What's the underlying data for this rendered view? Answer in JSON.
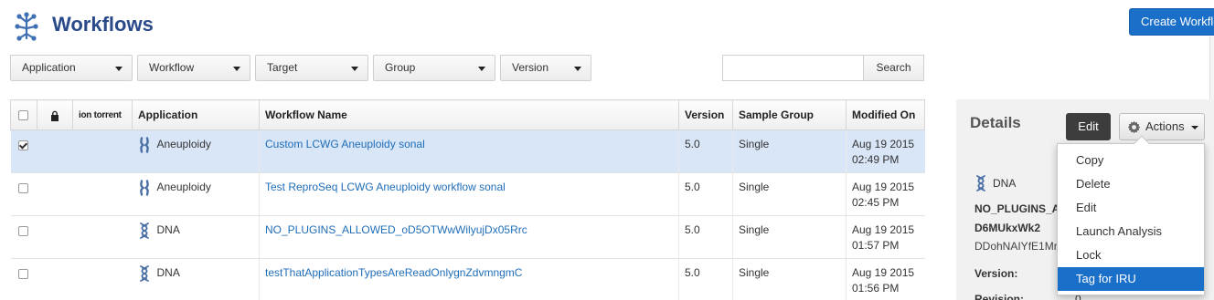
{
  "header": {
    "title": "Workflows",
    "create_button": "Create Workflow"
  },
  "filters": [
    {
      "label": "Application"
    },
    {
      "label": "Workflow"
    },
    {
      "label": "Target"
    },
    {
      "label": "Group"
    },
    {
      "label": "Version"
    }
  ],
  "search": {
    "value": "",
    "button": "Search"
  },
  "table": {
    "columns": [
      "",
      "",
      "ion torrent",
      "Application",
      "Workflow Name",
      "Version",
      "Sample Group",
      "Modified On"
    ],
    "rows": [
      {
        "checked": true,
        "app_icon": "chromosome-icon",
        "application": "Aneuploidy",
        "name": "Custom LCWG Aneuploidy sonal",
        "version": "5.0",
        "group": "Single",
        "date": "Aug 19 2015",
        "time": "02:49 PM"
      },
      {
        "checked": false,
        "app_icon": "chromosome-icon",
        "application": "Aneuploidy",
        "name": "Test ReproSeq LCWG Aneuploidy workflow sonal",
        "version": "5.0",
        "group": "Single",
        "date": "Aug 19 2015",
        "time": "02:45 PM"
      },
      {
        "checked": false,
        "app_icon": "dna-icon",
        "application": "DNA",
        "name": "NO_PLUGINS_ALLOWED_oD5OTWwWilyujDx05Rrc",
        "version": "5.0",
        "group": "Single",
        "date": "Aug 19 2015",
        "time": "01:57 PM"
      },
      {
        "checked": false,
        "app_icon": "dna-icon",
        "application": "DNA",
        "name": "testThatApplicationTypesAreReadOnlygnZdvmngmC",
        "version": "5.0",
        "group": "Single",
        "date": "Aug 19 2015",
        "time": "01:56 PM"
      }
    ]
  },
  "details": {
    "title": "Details",
    "edit_button": "Edit",
    "actions_button": "Actions",
    "application": "DNA",
    "name_line1": "NO_PLUGINS_A",
    "name_line2": "D6MUkxWk2",
    "id_line": "DDohNAIYfE1Mr",
    "version_label": "Version:",
    "revision_label": "Revision:",
    "revision_value": "0"
  },
  "actions_menu": {
    "items": [
      "Copy",
      "Delete",
      "Edit",
      "Launch Analysis",
      "Lock",
      "Tag for IRU"
    ],
    "highlighted": "Tag for IRU"
  },
  "colors": {
    "brand": "#2a4a8a",
    "primary": "#1a6fc9",
    "link": "#1f6db8",
    "selected_row": "#d9e6f7"
  }
}
